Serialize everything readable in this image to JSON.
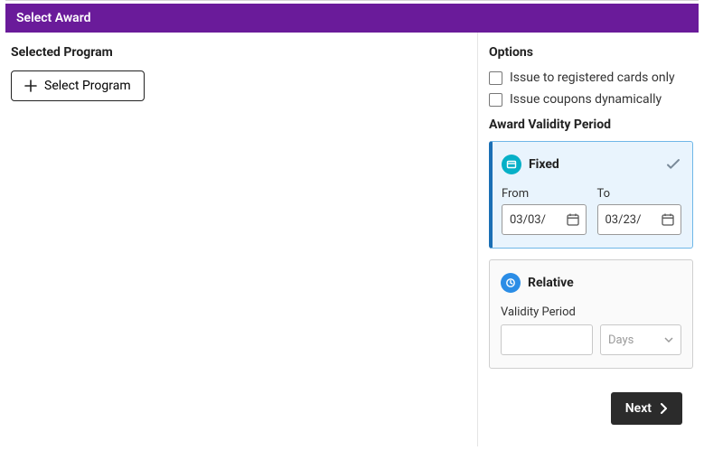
{
  "header": {
    "title": "Select Award"
  },
  "left": {
    "section_title": "Selected Program",
    "select_program_label": "Select Program"
  },
  "right": {
    "options_title": "Options",
    "opt_registered": "Issue to registered cards only",
    "opt_dynamic": "Issue coupons dynamically",
    "validity_title": "Award Validity Period",
    "fixed": {
      "title": "Fixed",
      "from_label": "From",
      "from_value": "03/03/",
      "to_label": "To",
      "to_value": "03/23/"
    },
    "relative": {
      "title": "Relative",
      "period_label": "Validity Period",
      "period_value": "",
      "unit": "Days"
    }
  },
  "footer": {
    "next_label": "Next"
  }
}
